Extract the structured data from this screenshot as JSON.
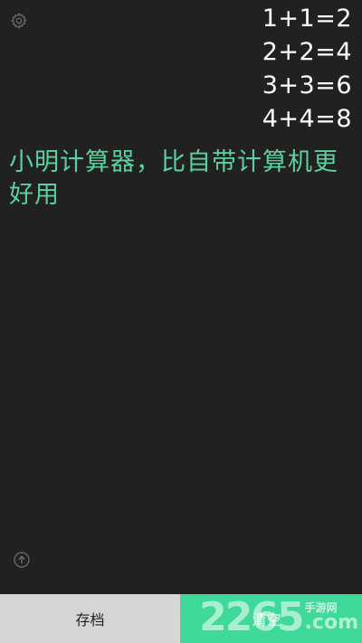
{
  "app": {
    "icons": {
      "settings": "gear-icon",
      "upload": "arrow-up-circle-icon"
    },
    "colors": {
      "background": "#212121",
      "accent": "#5bd1a0",
      "clear_button": "#3fd99a",
      "save_button": "#d6d6d6"
    }
  },
  "history": [
    "1+1=2",
    "2+2=4",
    "3+3=6",
    "4+4=8"
  ],
  "note": "小明计算器，比自带计算机更好用",
  "bottom_bar": {
    "save_label": "存档",
    "clear_label": "清空"
  },
  "watermark": {
    "number": "2265",
    "text": "手游网",
    "domain": ".com"
  }
}
